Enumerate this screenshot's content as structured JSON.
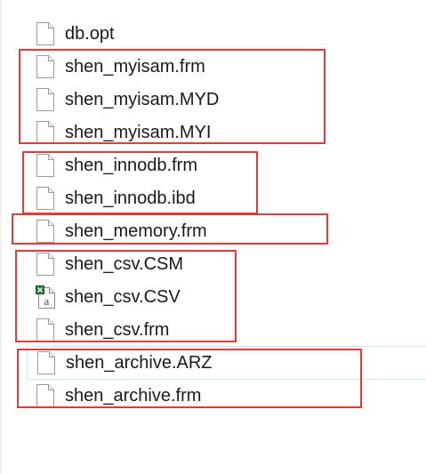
{
  "files": [
    {
      "name": "db.opt",
      "icon": "blank-file-icon"
    },
    {
      "name": "shen_myisam.frm",
      "icon": "blank-file-icon"
    },
    {
      "name": "shen_myisam.MYD",
      "icon": "blank-file-icon"
    },
    {
      "name": "shen_myisam.MYI",
      "icon": "blank-file-icon"
    },
    {
      "name": "shen_innodb.frm",
      "icon": "blank-file-icon"
    },
    {
      "name": "shen_innodb.ibd",
      "icon": "blank-file-icon"
    },
    {
      "name": "shen_memory.frm",
      "icon": "blank-file-icon"
    },
    {
      "name": "shen_csv.CSM",
      "icon": "blank-file-icon"
    },
    {
      "name": "shen_csv.CSV",
      "icon": "excel-csv-file-icon"
    },
    {
      "name": "shen_csv.frm",
      "icon": "blank-file-icon"
    },
    {
      "name": "shen_archive.ARZ",
      "icon": "blank-file-icon"
    },
    {
      "name": "shen_archive.frm",
      "icon": "blank-file-icon"
    }
  ],
  "colors": {
    "annotation_border": "#e23b3b",
    "selection_hint": "#cce8ff",
    "excel_green": "#1f7a3d"
  }
}
